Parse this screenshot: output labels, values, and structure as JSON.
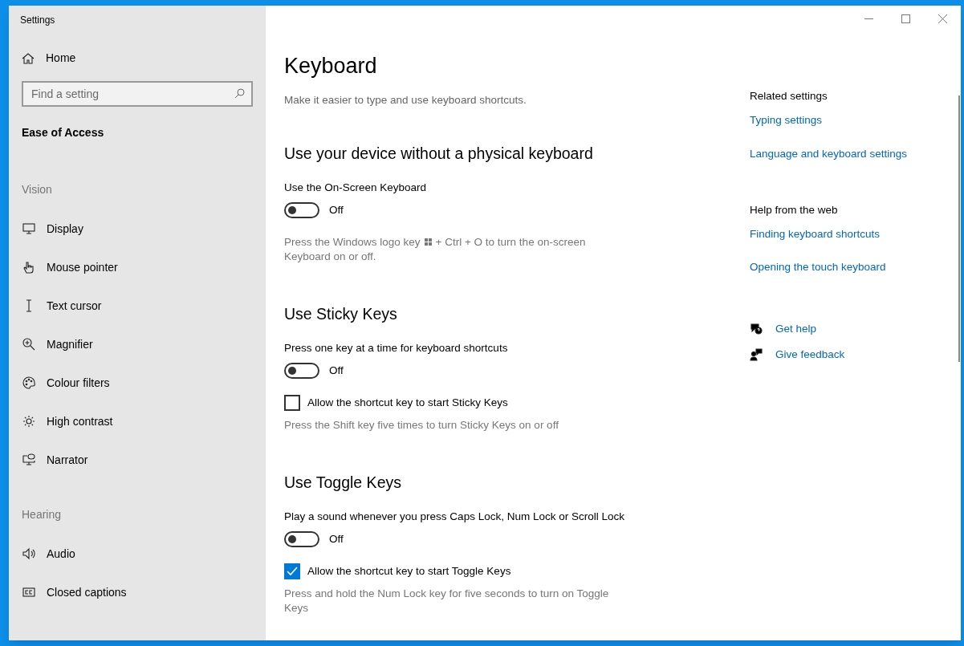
{
  "window": {
    "title": "Settings"
  },
  "sidebar": {
    "home": "Home",
    "search": {
      "placeholder": "Find a setting"
    },
    "category": "Ease of Access",
    "groups": [
      {
        "heading": "Vision",
        "items": [
          {
            "label": "Display",
            "kind": "display"
          },
          {
            "label": "Mouse pointer",
            "kind": "mouse"
          },
          {
            "label": "Text cursor",
            "kind": "cursor"
          },
          {
            "label": "Magnifier",
            "kind": "magnifier"
          },
          {
            "label": "Colour filters",
            "kind": "palette"
          },
          {
            "label": "High contrast",
            "kind": "sun"
          },
          {
            "label": "Narrator",
            "kind": "narrator"
          }
        ]
      },
      {
        "heading": "Hearing",
        "items": [
          {
            "label": "Audio",
            "kind": "audio"
          },
          {
            "label": "Closed captions",
            "kind": "captions"
          }
        ]
      }
    ]
  },
  "main": {
    "title": "Keyboard",
    "subtitle": "Make it easier to type and use keyboard shortcuts.",
    "sections": [
      {
        "heading": "Use your device without a physical keyboard",
        "items": [
          {
            "kind": "label",
            "text": "Use the On-Screen Keyboard"
          },
          {
            "kind": "toggle",
            "on": false,
            "state_label": "Off"
          },
          {
            "kind": "key_hint",
            "before": "Press the Windows logo key",
            "after": "+ Ctrl + O to turn the on-screen",
            "continuation": "Keyboard on or off."
          }
        ]
      },
      {
        "heading": "Use Sticky Keys",
        "items": [
          {
            "kind": "label",
            "text": "Press one key at a time for keyboard shortcuts"
          },
          {
            "kind": "toggle",
            "on": false,
            "state_label": "Off"
          },
          {
            "kind": "checkbox",
            "checked": false,
            "text": "Allow the shortcut key to start Sticky Keys"
          },
          {
            "kind": "hint",
            "text": "Press the Shift key five times to turn Sticky Keys on or off"
          }
        ]
      },
      {
        "heading": "Use Toggle Keys",
        "items": [
          {
            "kind": "label",
            "text": "Play a sound whenever you press Caps Lock, Num Lock or Scroll Lock"
          },
          {
            "kind": "toggle",
            "on": false,
            "state_label": "Off"
          },
          {
            "kind": "checkbox",
            "checked": true,
            "text": "Allow the shortcut key to start Toggle Keys"
          },
          {
            "kind": "hint",
            "text": "Press and hold the Num Lock key for five seconds to turn on Toggle Keys"
          }
        ]
      }
    ]
  },
  "aside": {
    "groups": [
      {
        "heading": "Related settings",
        "links": [
          "Typing settings",
          "Language and keyboard settings"
        ]
      },
      {
        "heading": "Help from the web",
        "links": [
          "Finding keyboard shortcuts",
          "Opening the touch keyboard"
        ]
      }
    ],
    "actions": [
      {
        "kind": "help",
        "label": "Get help"
      },
      {
        "kind": "feedback",
        "label": "Give feedback"
      }
    ]
  }
}
